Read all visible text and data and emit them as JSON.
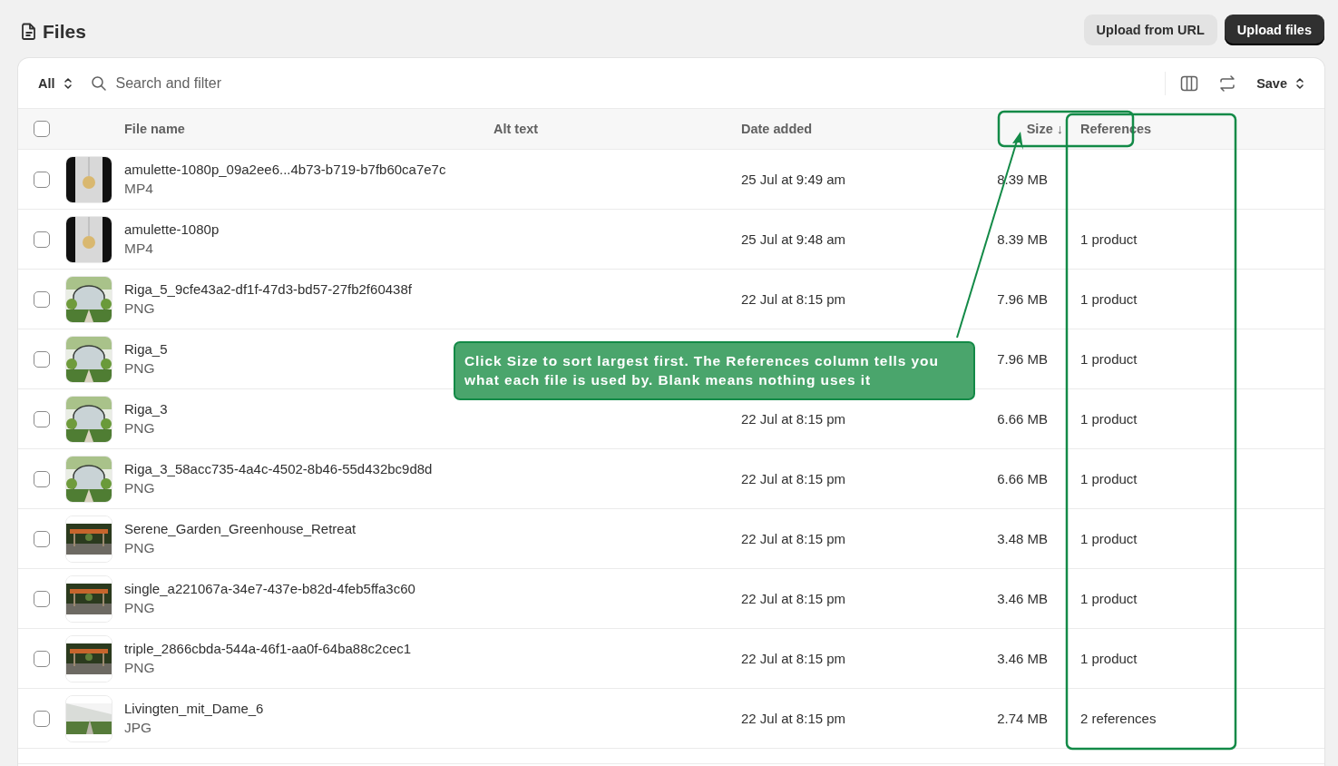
{
  "page": {
    "title": "Files"
  },
  "actions": [
    {
      "label": "Upload from URL",
      "kind": "secondary"
    },
    {
      "label": "Upload files",
      "kind": "primary"
    }
  ],
  "toolbar": {
    "view": "All",
    "search": {
      "placeholder": "Search and filter"
    },
    "save": "Save"
  },
  "table": {
    "all_selected": false,
    "columns": [
      "File name",
      "Alt text",
      "Date added",
      "Size ↓",
      "References"
    ],
    "rows": [
      {
        "name": "amulette-1080p_09a2ee6...4b73-b719-b7fb60ca7e7c",
        "type": "MP4",
        "date": "25 Jul at 9:49 am",
        "size": "8.39 MB",
        "selected": false
      },
      {
        "name": "amulette-1080p",
        "type": "MP4",
        "date": "25 Jul at 9:48 am",
        "size": "8.39 MB",
        "references": "1 product",
        "selected": false
      },
      {
        "name": "Riga_5_9cfe43a2-df1f-47d3-bd57-27fb2f60438f",
        "type": "PNG",
        "date": "22 Jul at 8:15 pm",
        "size": "7.96 MB",
        "references": "1 product",
        "selected": false
      },
      {
        "name": "Riga_5",
        "type": "PNG",
        "size": "7.96 MB",
        "references": "1 product",
        "selected": false
      },
      {
        "name": "Riga_3",
        "type": "PNG",
        "date": "22 Jul at 8:15 pm",
        "size": "6.66 MB",
        "references": "1 product",
        "selected": false
      },
      {
        "name": "Riga_3_58acc735-4a4c-4502-8b46-55d432bc9d8d",
        "type": "PNG",
        "date": "22 Jul at 8:15 pm",
        "size": "6.66 MB",
        "references": "1 product",
        "selected": false
      },
      {
        "name": "Serene_Garden_Greenhouse_Retreat",
        "type": "PNG",
        "date": "22 Jul at 8:15 pm",
        "size": "3.48 MB",
        "references": "1 product",
        "selected": false
      },
      {
        "name": "single_a221067a-34e7-437e-b82d-4feb5ffa3c60",
        "type": "PNG",
        "date": "22 Jul at 8:15 pm",
        "size": "3.46 MB",
        "references": "1 product",
        "selected": false
      },
      {
        "name": "triple_2866cbda-544a-46f1-aa0f-64ba88c2cec1",
        "type": "PNG",
        "date": "22 Jul at 8:15 pm",
        "size": "3.46 MB",
        "references": "1 product",
        "selected": false
      },
      {
        "name": "Livingten_mit_Dame_6",
        "type": "JPG",
        "date": "22 Jul at 8:15 pm",
        "size": "2.74 MB",
        "references": "2 references",
        "selected": false
      }
    ]
  },
  "annotation": {
    "text": "Click Size to sort largest first. The References column tells you what each file is used by. Blank means nothing uses it"
  }
}
